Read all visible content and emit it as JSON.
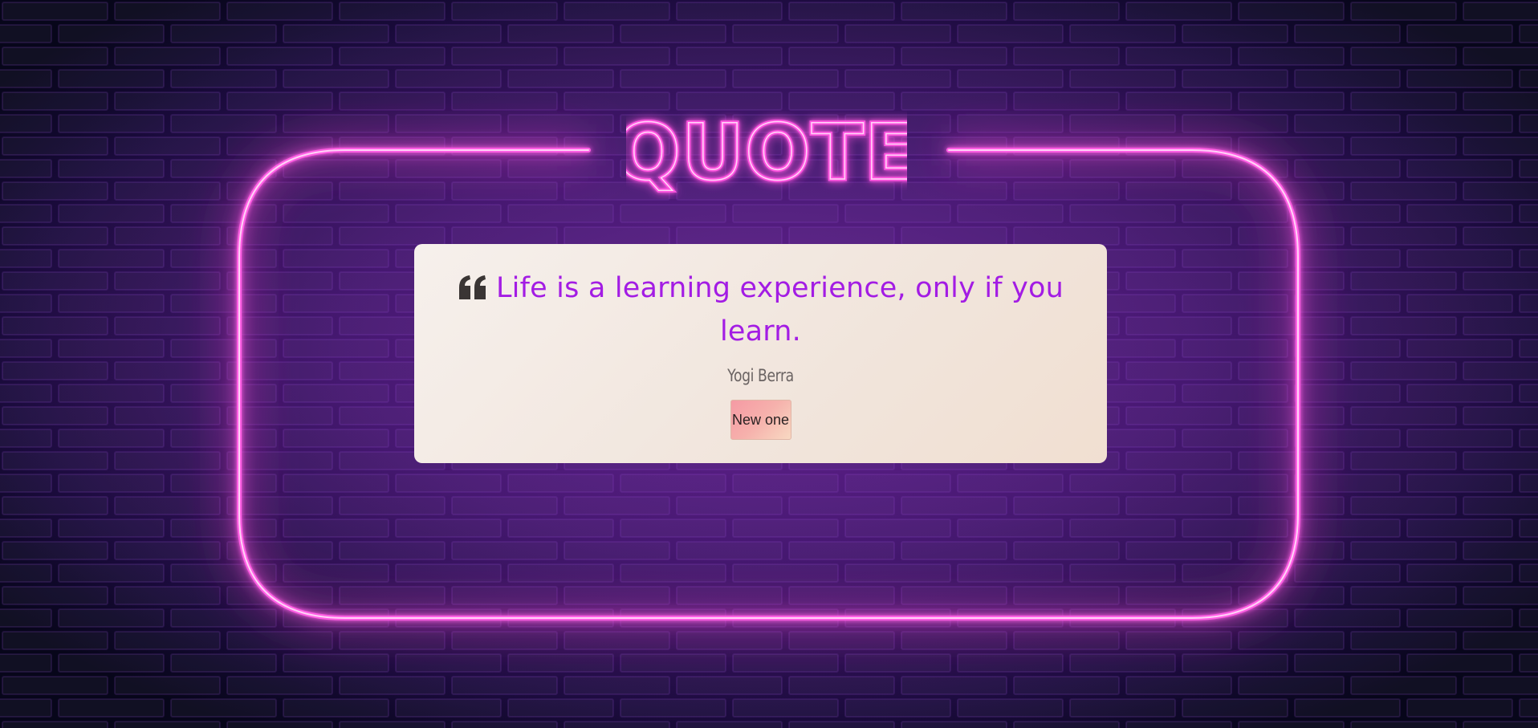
{
  "sign": {
    "title": "QUOTE"
  },
  "quote": {
    "text": "Life is a learning experience, only if you learn.",
    "author": "Yogi Berra",
    "icon": "quote-left-icon"
  },
  "actions": {
    "new_label": "New one"
  },
  "colors": {
    "neon_pink": "#ff4fe0",
    "quote_text": "#a31ce4",
    "brick": "#3d1a6b"
  }
}
